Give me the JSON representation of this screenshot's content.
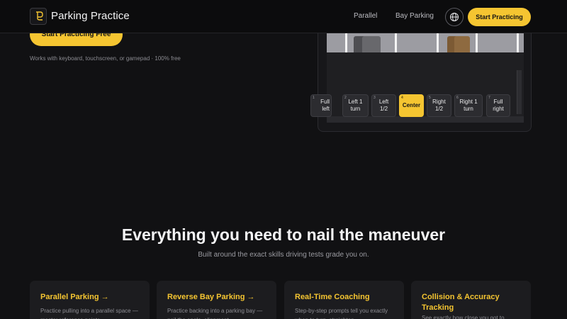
{
  "header": {
    "brand": "Parking Practice",
    "nav": [
      {
        "label": "Parallel"
      },
      {
        "label": "Bay Parking"
      }
    ],
    "language_icon": "globe-icon",
    "cta_label": "Start Practicing"
  },
  "hero": {
    "cta_label": "Start Practicing Free",
    "note": "Works with keyboard, touchscreen, or gamepad · 100% free"
  },
  "preview": {
    "steering": [
      {
        "num": "1",
        "label": "Full left"
      },
      {
        "num": "2",
        "label": "Left 1 turn"
      },
      {
        "num": "3",
        "label": "Left 1/2"
      },
      {
        "num": "4",
        "label": "Center",
        "active": true
      },
      {
        "num": "5",
        "label": "Right 1/2"
      },
      {
        "num": "6",
        "label": "Right 1 turn"
      },
      {
        "num": "7",
        "label": "Full right"
      }
    ]
  },
  "features": {
    "title": "Everything you need to nail the maneuver",
    "subtitle": "Built around the exact skills driving tests grade you on.",
    "cards": [
      {
        "title": "Parallel Parking →",
        "desc": "Practice pulling into a parallel space — master reference points"
      },
      {
        "title": "Reverse Bay Parking →",
        "desc": "Practice backing into a parking bay — nail the angle, alignment"
      },
      {
        "title": "Real-Time Coaching",
        "desc": "Step-by-step prompts tell you exactly when to turn, straighten"
      },
      {
        "title": "Collision & Accuracy Tracking",
        "desc": "See exactly how close you got to"
      }
    ]
  },
  "colors": {
    "accent": "#f5c531",
    "background": "#111113",
    "card": "#1c1c1f"
  }
}
